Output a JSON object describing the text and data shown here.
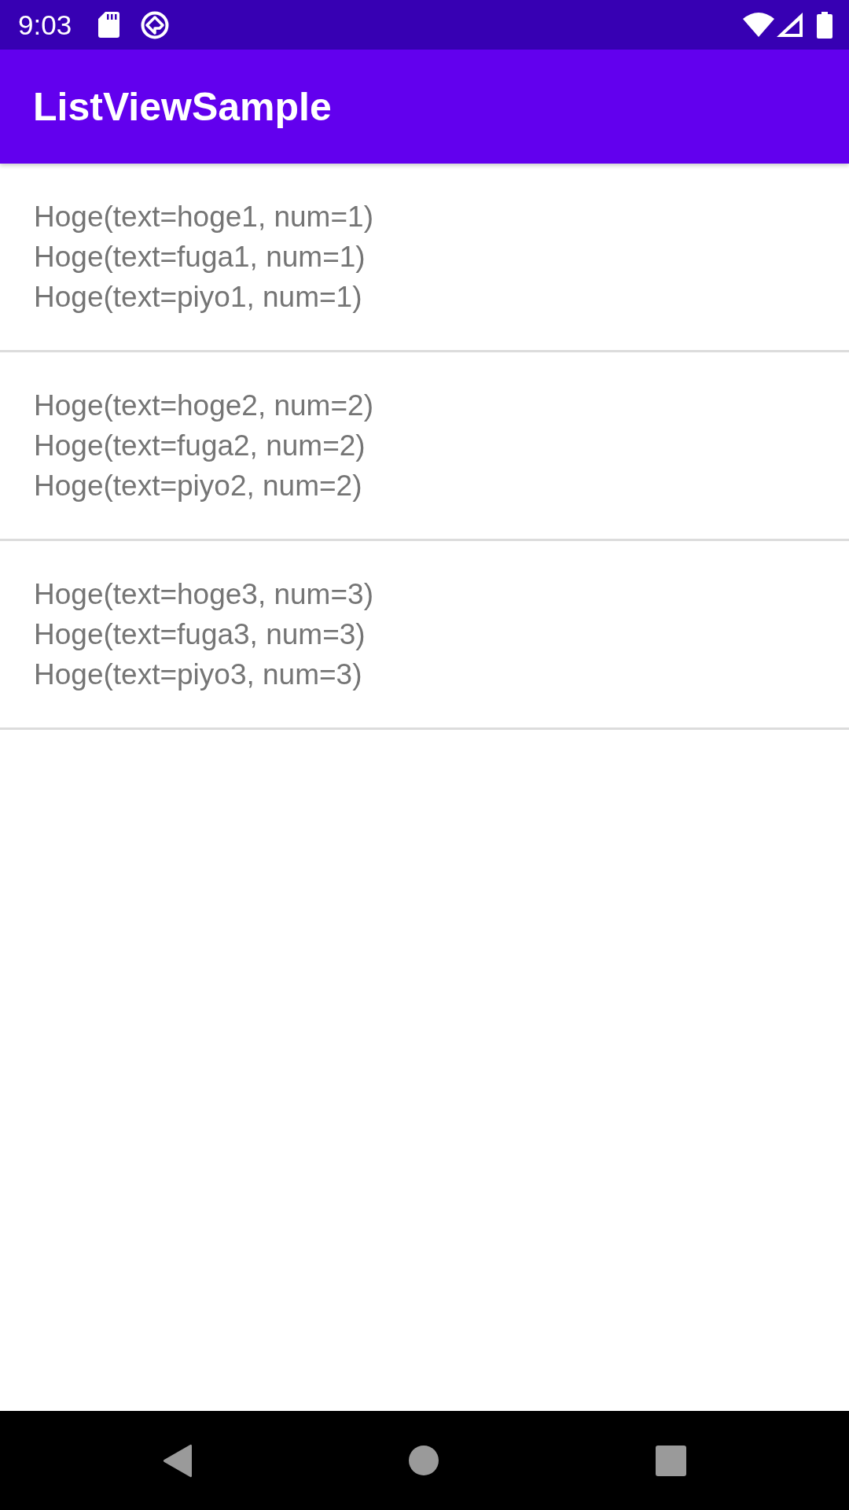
{
  "status_bar": {
    "time": "9:03"
  },
  "app_bar": {
    "title": "ListViewSample"
  },
  "list": {
    "items": [
      {
        "lines": [
          "Hoge(text=hoge1, num=1)",
          "Hoge(text=fuga1, num=1)",
          "Hoge(text=piyo1, num=1)"
        ]
      },
      {
        "lines": [
          "Hoge(text=hoge2, num=2)",
          "Hoge(text=fuga2, num=2)",
          "Hoge(text=piyo2, num=2)"
        ]
      },
      {
        "lines": [
          "Hoge(text=hoge3, num=3)",
          "Hoge(text=fuga3, num=3)",
          "Hoge(text=piyo3, num=3)"
        ]
      }
    ]
  }
}
